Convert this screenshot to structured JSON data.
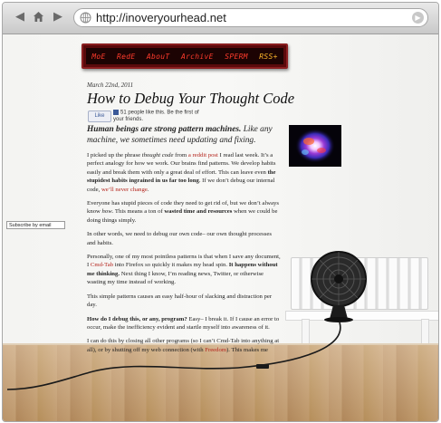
{
  "browser": {
    "url": "http://inoveryourhead.net",
    "back_icon": "left-arrow-icon",
    "forward_icon": "right-arrow-icon",
    "home_icon": "home-icon"
  },
  "nav": {
    "items": [
      "MoE",
      "RedE",
      "AbouT",
      "ArchivE",
      "SPERM",
      "RSS+"
    ]
  },
  "post": {
    "date": "March 22nd, 2011",
    "title": "How to Debug Your Thought Code",
    "like_label": "Like",
    "like_text": "51 people like this. Be the first of your friends.",
    "lead_bold": "Human beings are strong pattern machines.",
    "lead_rest": " Like any machine, we sometimes need updating and fixing.",
    "p1_a": "I picked up the phrase ",
    "p1_em": "thought code",
    "p1_b": " from ",
    "p1_link": "a reddit post",
    "p1_c": " I read last week. It’s a perfect analogy for how we work. Our brains find patterns. We develop habits easily and break them with only a great deal of effort. This can leave even ",
    "p1_bold": "the stupidest habits ingrained in us far too long",
    "p1_d": ". If we don’t debug our internal code, ",
    "p1_link2": "we’ll never change",
    "p1_e": ".",
    "p2_a": "Everyone has stupid pieces of code they need to get rid of, but we don’t always know ",
    "p2_em": "how",
    "p2_b": ". This means a ton of ",
    "p2_bold": "wasted time and resources",
    "p2_c": " when we could be doing things simply.",
    "p3": "In other words, we need to debug our own code– our own thought processes and habits.",
    "p4_a": "Personally, one of my most pointless patterns is that when I save any document, I ",
    "p4_link": "Cmd-Tab",
    "p4_b": " into Firefox so quickly it makes my head spin. ",
    "p4_bold": "It happens without me thinking.",
    "p4_c": " Next thing I know, I’m reading news, Twitter, or otherwise wasting my time instead of working.",
    "p5": "This simple patterns causes an easy half-hour of slacking and distraction per day.",
    "p6_bold": "How do I debug this, or any, program?",
    "p6_rest": " Easy– I break it. If I cause an error to occur, make the inefficiency evident and startle myself into awareness of it.",
    "p7_a": "I can do this by closing all other programs (so I can’t Cmd-Tab into anything at all), or by shutting off my web connection (with ",
    "p7_link": "Freedom",
    "p7_b": "). This makes me"
  },
  "sidebar": {
    "subscribe_label": "Subscribe by email"
  }
}
